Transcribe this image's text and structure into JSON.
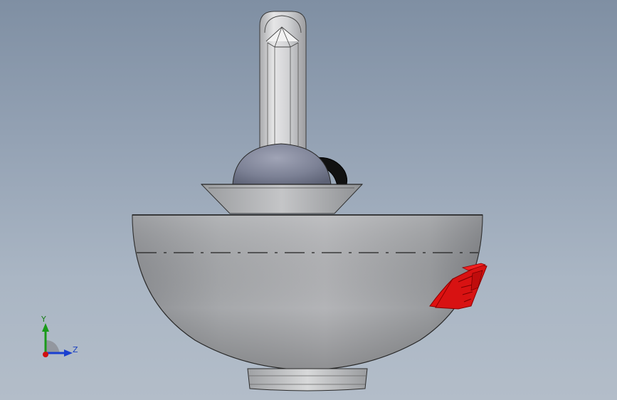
{
  "viewport": {
    "background_top": "#7f8fa3",
    "background_bottom": "#b3bdc9"
  },
  "model": {
    "body_color": "#9c9ea2",
    "sphere_color": "#7a7f93",
    "handle_color": "#c9c9cb",
    "red_part_color": "#e01010",
    "black_part_color": "#111111"
  },
  "triad": {
    "y_label": "Y",
    "z_label": "Z",
    "y_color": "#1a9a1a",
    "z_color": "#1a3fd0",
    "x_color": "#d01010"
  }
}
